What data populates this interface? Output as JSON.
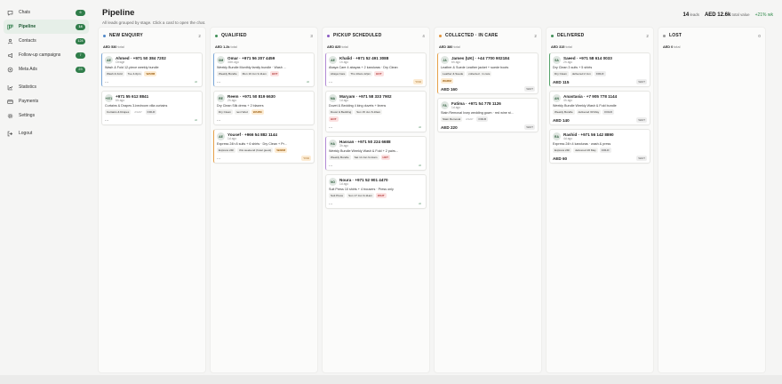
{
  "sidebar": {
    "items": [
      {
        "label": "Chats",
        "badge": "6",
        "icon": "chat-icon"
      },
      {
        "label": "Pipeline",
        "badge": "14",
        "icon": "pipeline-icon",
        "active": true
      },
      {
        "label": "Contacts",
        "badge": "124",
        "icon": "contacts-icon"
      },
      {
        "label": "Follow-up campaigns",
        "badge": "7",
        "icon": "campaign-icon"
      },
      {
        "label": "Meta Ads",
        "badge": "23",
        "icon": "ads-icon"
      },
      {
        "label": "Statistics",
        "badge": "",
        "icon": "stats-icon"
      },
      {
        "label": "Payments",
        "badge": "",
        "icon": "payments-icon"
      },
      {
        "label": "Settings",
        "badge": "",
        "icon": "gear-icon"
      },
      {
        "label": "Logout",
        "badge": "",
        "icon": "logout-icon"
      }
    ]
  },
  "header": {
    "title": "Pipeline",
    "subtitle": "All leads grouped by stage. Click a card to open the chat.",
    "leads_count": "14",
    "leads_label": "leads",
    "total_value": "AED 12.6k",
    "total_label": "total value",
    "growth": "+21% wk"
  },
  "columns": [
    {
      "title": "NEW ENQUIRY",
      "count": "2",
      "total_amount": "AED 530",
      "total_label": "total",
      "color": "#4f86c6",
      "cards": [
        {
          "initials": "AE",
          "name": "Ahmed · +971 50 384 7202",
          "ago": "Orrage",
          "desc": "Wash & Fold 12-piece weekly bundle",
          "tags": [
            {
              "t": "Wash & Fold",
              "k": ""
            },
            {
              "t": "Tue 4-6pm",
              "k": "date"
            },
            {
              "t": "WARM",
              "k": "warn"
            }
          ],
          "foot": "...",
          "status": "AI",
          "status_k": "ai",
          "border": "bl"
        },
        {
          "initials": "+971",
          "name": "+971 55 612 8841",
          "ago": "6h ago",
          "desc": "Curtains & Drapes 3-bedroom villa curtains",
          "tags": [
            {
              "t": "Curtains & Drapes",
              "k": ""
            },
            {
              "t": "ASAP",
              "k": "muted"
            },
            {
              "t": "COLD",
              "k": "cold"
            }
          ],
          "foot": "...",
          "status": "AI",
          "status_k": "ai",
          "border": ""
        }
      ]
    },
    {
      "title": "QUALIFIED",
      "count": "3",
      "total_amount": "AED 1.2k",
      "total_label": "total",
      "color": "#3f8f56",
      "cards": [
        {
          "initials": "OM",
          "name": "Omar · +971 56 207 4459",
          "ago": "30m ago",
          "desc": "Weekly Bundle Monthly family bundle · Wash ...",
          "tags": [
            {
              "t": "Weekly Bundle",
              "k": ""
            },
            {
              "t": "Mon 16 Jun 9-11am",
              "k": "date"
            },
            {
              "t": "HOT",
              "k": "hot"
            }
          ],
          "foot": "...",
          "status": "AI",
          "status_k": "ai",
          "border": "bl"
        },
        {
          "initials": "RE",
          "name": "Reem · +971 50 819 6630",
          "ago": "2h ago",
          "desc": "Dry Clean Silk dress + 2 blazers",
          "tags": [
            {
              "t": "Dry Clean",
              "k": ""
            },
            {
              "t": "next Wed",
              "k": "date"
            },
            {
              "t": "WARM",
              "k": "warn"
            }
          ],
          "foot": "...",
          "status": "",
          "status_k": "",
          "border": ""
        },
        {
          "initials": "AE",
          "name": "Yousef · +966 54 882 1144",
          "ago": "1d ago",
          "desc": "Express 24h 8 suits + 6 shirts · Dry Clean + Pr...",
          "tags": [
            {
              "t": "Express 24h",
              "k": ""
            },
            {
              "t": "this weekend (hotel guest)",
              "k": "date"
            },
            {
              "t": "WARM",
              "k": "warn"
            }
          ],
          "foot": "...",
          "status": "YOU",
          "status_k": "you",
          "border": "bl-o"
        }
      ]
    },
    {
      "title": "PICKUP SCHEDULED",
      "count": "4",
      "total_amount": "AED 825",
      "total_label": "total",
      "color": "#8a5bc2",
      "cards": [
        {
          "initials": "AE",
          "name": "Khalid · +971 52 491 3088",
          "ago": "1h ago",
          "desc": "Abaya Care 4 abayas + 2 kanduras · Dry Clean",
          "tags": [
            {
              "t": "Abaya Care",
              "k": ""
            },
            {
              "t": "Thu 10am-12pm",
              "k": "date"
            },
            {
              "t": "HOT",
              "k": "hot"
            }
          ],
          "foot": "...",
          "status": "YOU",
          "status_k": "you",
          "border": "bl-p"
        },
        {
          "initials": "MA",
          "name": "Maryam · +971 58 333 7902",
          "ago": "1d ago",
          "desc": "Duvet & Bedding 4 king duvets + linens",
          "tags": [
            {
              "t": "Duvet & Bedding",
              "k": ""
            },
            {
              "t": "Sun 15 Jun 8-10am",
              "k": "date"
            }
          ],
          "tag_row2": "HOT",
          "foot": "...",
          "status": "AI",
          "status_k": "ai",
          "border": ""
        },
        {
          "initials": "HA",
          "name": "Hassan · +971 50 224 6688",
          "ago": "3h ago",
          "desc": "Weekly Bundle Weekly Wash & Fold + 2 pairs...",
          "tags": [
            {
              "t": "Weekly Bundle",
              "k": ""
            },
            {
              "t": "Sat 14 Jun 9-11am",
              "k": "date"
            },
            {
              "t": "HOT",
              "k": "hot"
            }
          ],
          "foot": "...",
          "status": "AI",
          "status_k": "ai",
          "border": "bl-p"
        },
        {
          "initials": "NO",
          "name": "Noura · +971 52 901 4470",
          "ago": "1d ago",
          "desc": "Suit Press 10 shirts + 4 trousers · Press only",
          "tags": [
            {
              "t": "Suit Press",
              "k": ""
            },
            {
              "t": "Sun 17 Jun 9-11am",
              "k": "date"
            },
            {
              "t": "WAIT",
              "k": "hot"
            }
          ],
          "foot": "...",
          "status": "AI",
          "status_k": "ai",
          "border": ""
        }
      ]
    },
    {
      "title": "COLLECTED · IN CARE",
      "count": "2",
      "total_amount": "AED 380",
      "total_label": "total",
      "color": "#e0923a",
      "cards": [
        {
          "initials": "JA",
          "name": "James (UK) · +44 7700 902184",
          "ago": "6h ago",
          "desc": "Leather & Suede Leather jacket + suede boots",
          "tags": [
            {
              "t": "Leather & Suede",
              "k": ""
            },
            {
              "t": "collected · in care",
              "k": "date"
            }
          ],
          "tag_row2": "WARM",
          "foot": "AED 160",
          "status": "WAIT",
          "status_k": "",
          "border": "bl-o"
        },
        {
          "initials": "FA",
          "name": "Fatima · +971 54 778 1126",
          "ago": "1d ago",
          "desc": "Stain Removal Ivory wedding gown · red wine st...",
          "tags": [
            {
              "t": "Stain Removal",
              "k": ""
            },
            {
              "t": "ASAP",
              "k": "muted"
            },
            {
              "t": "COLD",
              "k": "cold"
            }
          ],
          "foot": "AED 220",
          "status": "WAIT",
          "status_k": "",
          "border": ""
        }
      ]
    },
    {
      "title": "DELIVERED",
      "count": "2",
      "total_amount": "AED 315",
      "total_label": "total",
      "color": "#3f8f56",
      "cards": [
        {
          "initials": "SA",
          "name": "Saeed · +971 58 614 0033",
          "ago": "2h ago",
          "desc": "Dry Clean 3 suits + 5 shirts",
          "tags": [
            {
              "t": "Dry Clean",
              "k": ""
            },
            {
              "t": "delivered 2 Jun",
              "k": "date"
            },
            {
              "t": "COLD",
              "k": "cold"
            }
          ],
          "foot": "AED 115",
          "status": "WAIT",
          "status_k": "",
          "border": "bl-g"
        },
        {
          "initials": "AN",
          "name": "Anastasia · +7 905 778 1144",
          "ago": "4h ago",
          "desc": "Weekly Bundle Weekly Wash & Fold bundle",
          "tags": [
            {
              "t": "Weekly Bundle",
              "k": ""
            },
            {
              "t": "delivered 30 May",
              "k": "date"
            },
            {
              "t": "COLD",
              "k": "cold"
            }
          ],
          "foot": "AED 140",
          "status": "WAIT",
          "status_k": "",
          "border": ""
        },
        {
          "initials": "RA",
          "name": "Rashid · +971 56 142 8890",
          "ago": "4d ago",
          "desc": "Express 24h 4 kanduras · wash & press",
          "tags": [
            {
              "t": "Express 24h",
              "k": ""
            },
            {
              "t": "delivered 26 May",
              "k": "date"
            },
            {
              "t": "COLD",
              "k": "cold"
            }
          ],
          "foot": "AED 60",
          "status": "WAIT",
          "status_k": "",
          "border": ""
        }
      ]
    },
    {
      "title": "LOST",
      "count": "0",
      "total_amount": "AED 0",
      "total_label": "total",
      "color": "#999999",
      "cards": []
    }
  ]
}
